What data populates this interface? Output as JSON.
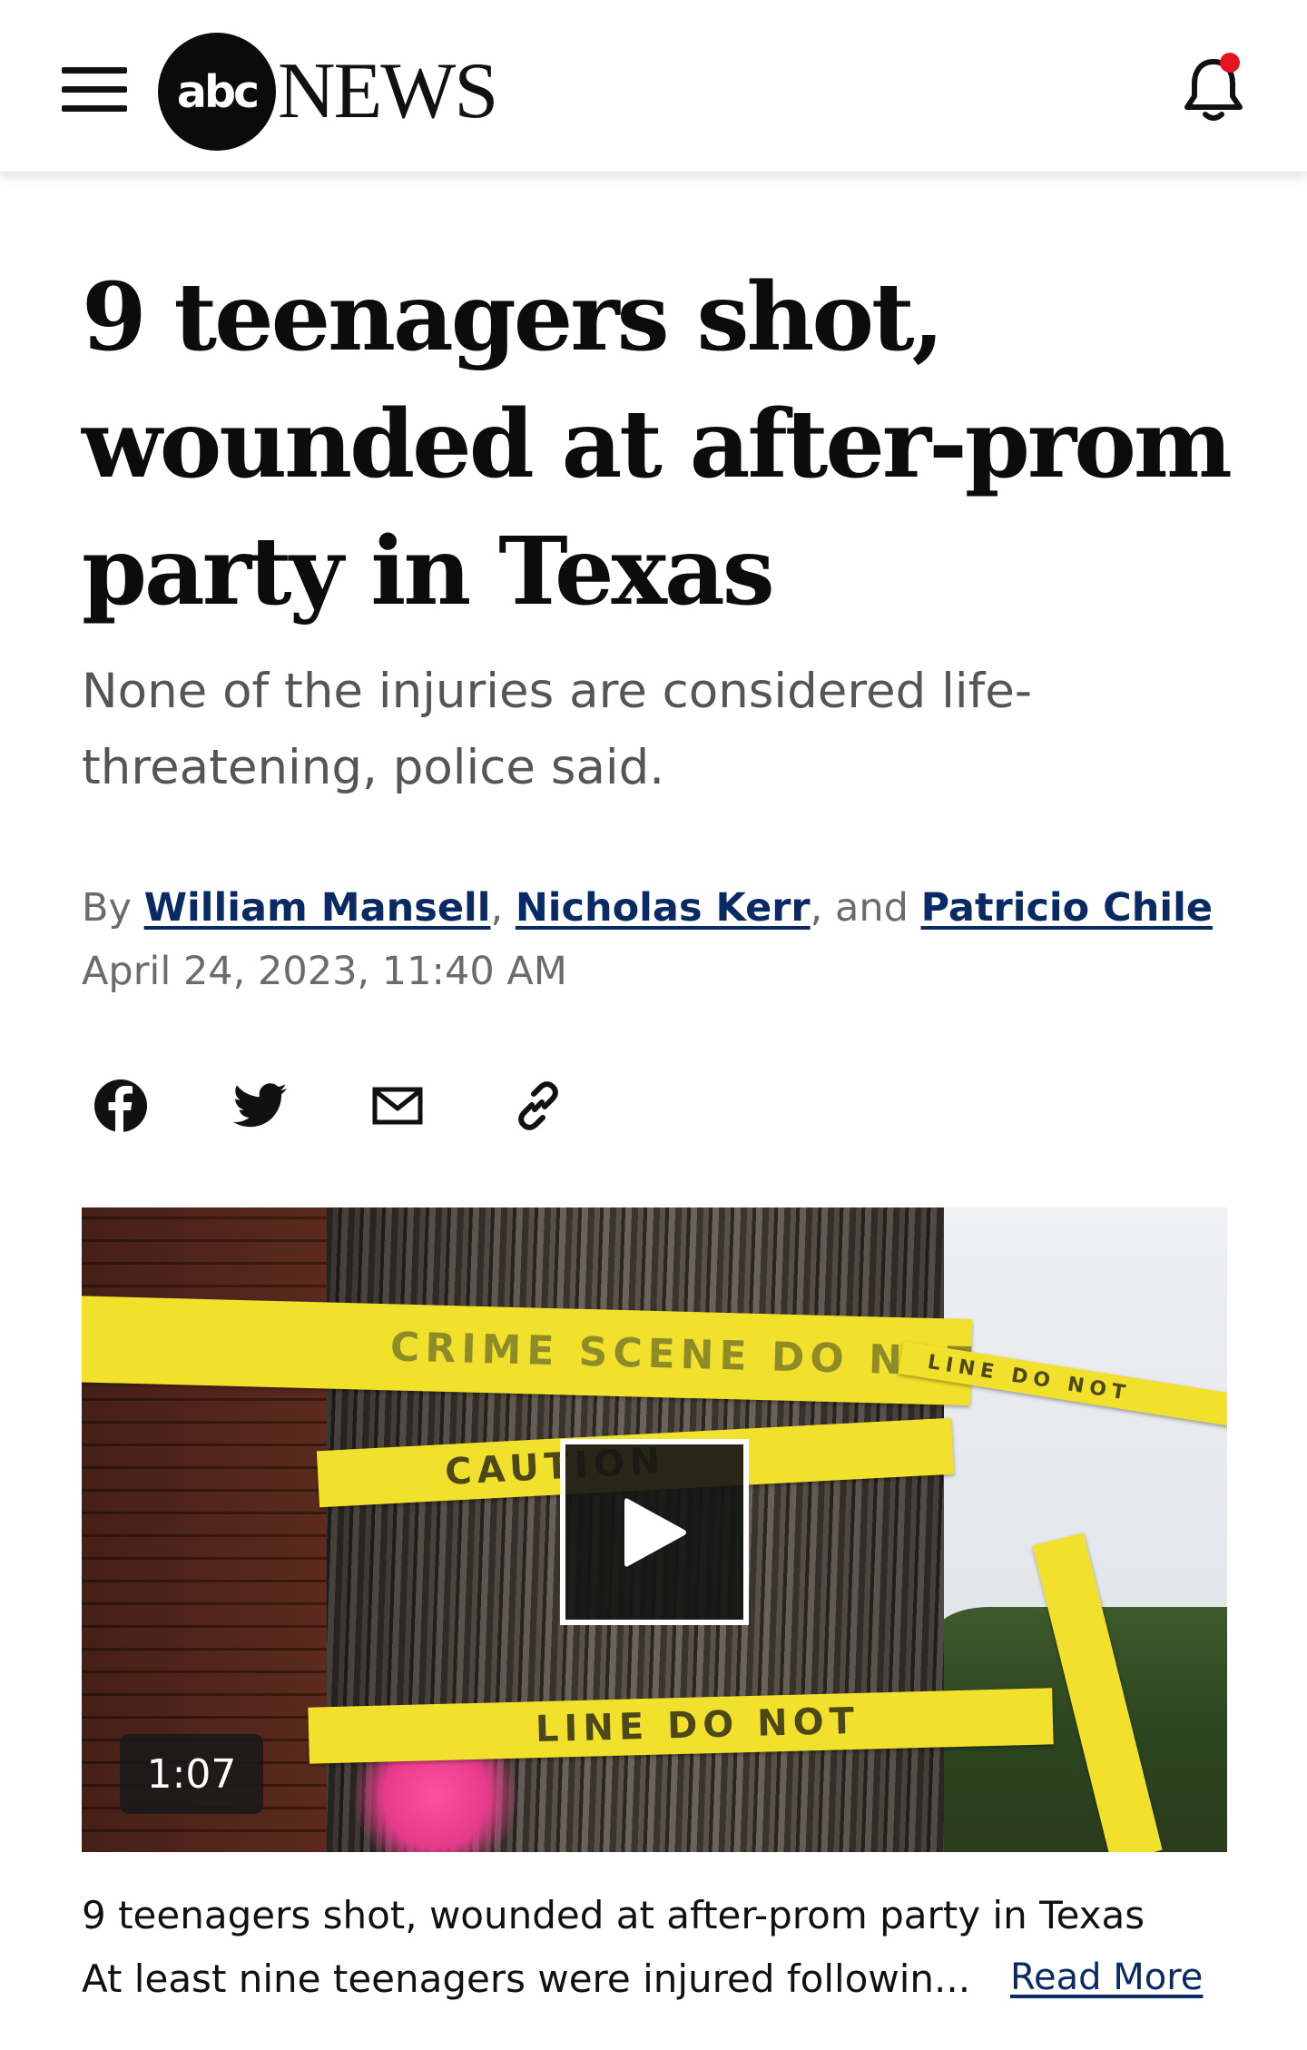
{
  "header": {
    "menu_icon": "hamburger-menu-icon",
    "logo_abc": "abc",
    "logo_news": "NEWS",
    "notification_icon": "bell-icon",
    "notification_dot_color": "#e5141f"
  },
  "article": {
    "headline": "9 teenagers shot, wounded at after-prom party in Texas",
    "subheadline": "None of the injuries are considered life-threatening, police said.",
    "byline": {
      "prefix": "By ",
      "authors": [
        "William Mansell",
        "Nicholas Kerr",
        "Patricio Chile"
      ],
      "sep1": ", ",
      "sep2": ", and ",
      "author_link_color": "#0a2a66"
    },
    "date": "April 24, 2023, 11:40 AM",
    "share_icons": [
      "facebook-icon",
      "twitter-icon",
      "email-icon",
      "copy-link-icon"
    ]
  },
  "video": {
    "duration": "1:07",
    "play_icon": "play-icon",
    "tape_text_1": "CRIME SCENE DO NOT CROSS",
    "tape_text_2": "CAUTION",
    "tape_text_3": "LINE DO NOT"
  },
  "caption": {
    "title": "9 teenagers shot, wounded at after-prom party in Texas",
    "description": "At least nine teenagers were injured followin...",
    "read_more": "Read More"
  }
}
